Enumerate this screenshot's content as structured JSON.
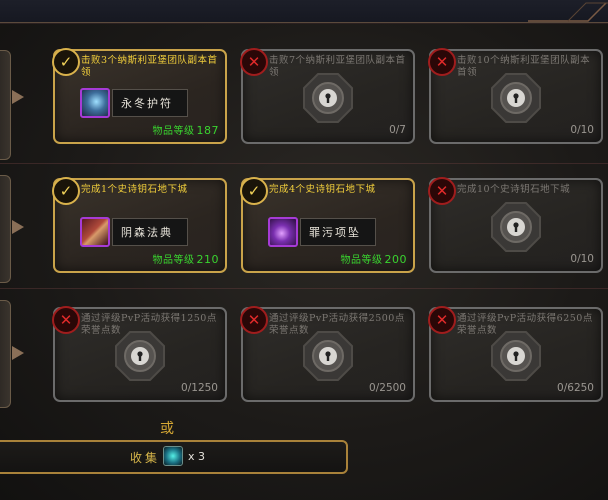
{
  "rows": [
    {
      "cards": [
        {
          "state": "done",
          "requirement": "击败3个纳斯利亚堡团队副本首领",
          "reward": {
            "name": "永冬护符",
            "ilvl_label": "物品等级",
            "ilvl": "187",
            "icon": "ice-trinket-icon"
          }
        },
        {
          "state": "locked",
          "requirement": "击败7个纳斯利亚堡团队副本首领",
          "progress": "0/7"
        },
        {
          "state": "locked",
          "requirement": "击败10个纳斯利亚堡团队副本首领",
          "progress": "0/10"
        }
      ]
    },
    {
      "cards": [
        {
          "state": "done",
          "requirement": "完成1个史诗钥石地下城",
          "reward": {
            "name": "阴森法典",
            "ilvl_label": "物品等级",
            "ilvl": "210",
            "icon": "tome-icon"
          }
        },
        {
          "state": "done",
          "requirement": "完成4个史诗钥石地下城",
          "reward": {
            "name": "罪污项坠",
            "ilvl_label": "物品等级",
            "ilvl": "200",
            "icon": "necklace-icon"
          }
        },
        {
          "state": "locked",
          "requirement": "完成10个史诗钥石地下城",
          "progress": "0/10"
        }
      ]
    },
    {
      "cards": [
        {
          "state": "locked",
          "requirement": "通过评级PvP活动获得1250点荣誉点数",
          "progress": "0/1250"
        },
        {
          "state": "locked",
          "requirement": "通过评级PvP活动获得2500点荣誉点数",
          "progress": "0/2500"
        },
        {
          "state": "locked",
          "requirement": "通过评级PvP活动获得6250点荣誉点数",
          "progress": "0/6250"
        }
      ]
    }
  ],
  "or_label": "或",
  "collect": {
    "label": "收集",
    "quantity": "x 3",
    "icon": "valor-crystal-icon"
  },
  "colors": {
    "gold_border": "#c9a34a",
    "locked_border": "#6b6b6b",
    "ilvl_green": "#39d32f",
    "requirement_gold": "#f2cf3b"
  }
}
